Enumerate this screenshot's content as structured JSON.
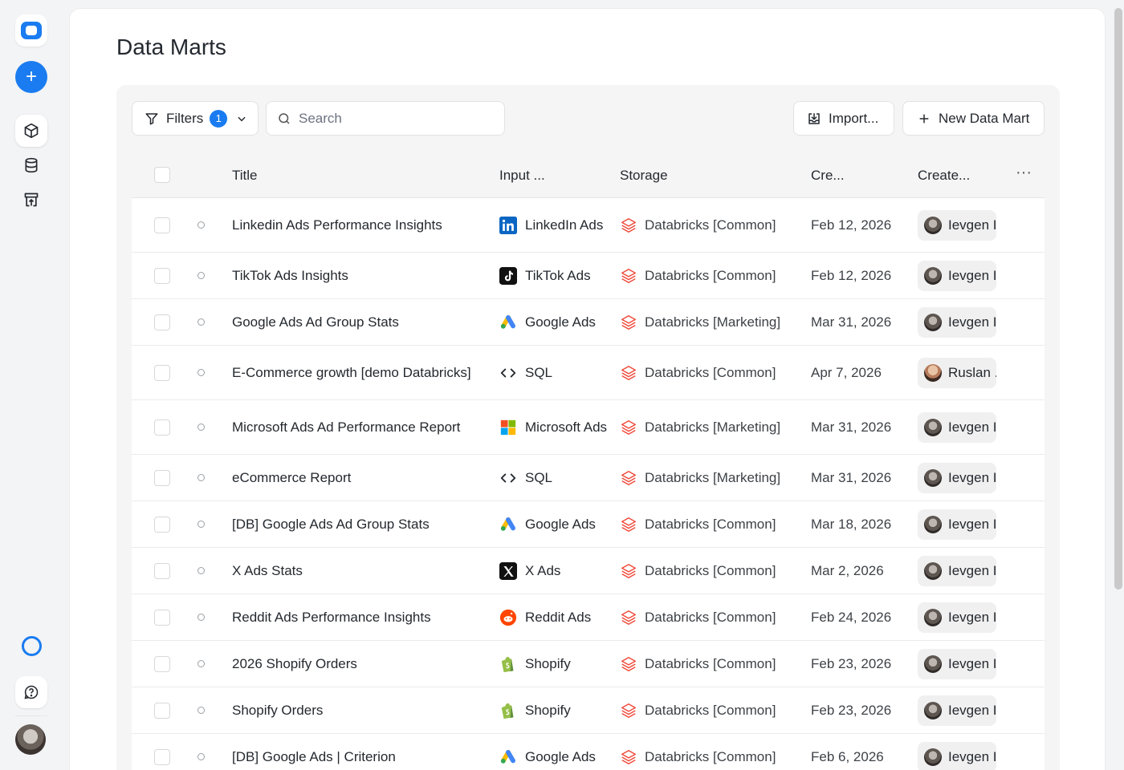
{
  "page": {
    "title": "Data Marts"
  },
  "toolbar": {
    "filters_label": "Filters",
    "filters_count": "1",
    "search_placeholder": "Search",
    "import_label": "Import...",
    "new_label": "New Data Mart"
  },
  "columns": {
    "title": "Title",
    "input": "Input ...",
    "storage": "Storage",
    "created": "Cre...",
    "creator": "Create...",
    "more": "···"
  },
  "rows": [
    {
      "title": "Linkedin Ads Performance Insights",
      "input": "LinkedIn Ads",
      "input_icon": "linkedin-icon",
      "storage": "Databricks [Common]",
      "date": "Feb 12, 2026",
      "creator": "Ievgen I"
    },
    {
      "title": "TikTok Ads Insights",
      "input": "TikTok Ads",
      "input_icon": "tiktok-icon",
      "storage": "Databricks [Common]",
      "date": "Feb 12, 2026",
      "creator": "Ievgen I"
    },
    {
      "title": "Google Ads Ad Group Stats",
      "input": "Google Ads",
      "input_icon": "google-ads-icon",
      "storage": "Databricks [Marketing]",
      "date": "Mar 31, 2026",
      "creator": "Ievgen I"
    },
    {
      "title": "E-Commerce growth [demo Databricks]",
      "input": "SQL",
      "input_icon": "code-icon",
      "storage": "Databricks [Common]",
      "date": "Apr 7, 2026",
      "creator": "Ruslan ."
    },
    {
      "title": "Microsoft Ads Ad Performance Report",
      "input": "Microsoft Ads",
      "input_icon": "microsoft-icon",
      "storage": "Databricks [Marketing]",
      "date": "Mar 31, 2026",
      "creator": "Ievgen I"
    },
    {
      "title": "eCommerce Report",
      "input": "SQL",
      "input_icon": "code-icon",
      "storage": "Databricks [Marketing]",
      "date": "Mar 31, 2026",
      "creator": "Ievgen I"
    },
    {
      "title": "[DB] Google Ads Ad Group Stats",
      "input": "Google Ads",
      "input_icon": "google-ads-icon",
      "storage": "Databricks [Common]",
      "date": "Mar 18, 2026",
      "creator": "Ievgen I"
    },
    {
      "title": "X Ads Stats",
      "input": "X Ads",
      "input_icon": "x-icon",
      "storage": "Databricks [Common]",
      "date": "Mar 2, 2026",
      "creator": "Ievgen I"
    },
    {
      "title": "Reddit Ads Performance Insights",
      "input": "Reddit Ads",
      "input_icon": "reddit-icon",
      "storage": "Databricks [Common]",
      "date": "Feb 24, 2026",
      "creator": "Ievgen I"
    },
    {
      "title": "2026 Shopify Orders",
      "input": "Shopify",
      "input_icon": "shopify-icon",
      "storage": "Databricks [Common]",
      "date": "Feb 23, 2026",
      "creator": "Ievgen I"
    },
    {
      "title": "Shopify Orders",
      "input": "Shopify",
      "input_icon": "shopify-icon",
      "storage": "Databricks [Common]",
      "date": "Feb 23, 2026",
      "creator": "Ievgen I"
    },
    {
      "title": "[DB] Google Ads | Criterion",
      "input": "Google Ads",
      "input_icon": "google-ads-icon",
      "storage": "Databricks [Common]",
      "date": "Feb 6, 2026",
      "creator": "Ievgen I"
    }
  ],
  "colors": {
    "accent": "#1a7cf0",
    "databricks": "#ef4a3a"
  }
}
